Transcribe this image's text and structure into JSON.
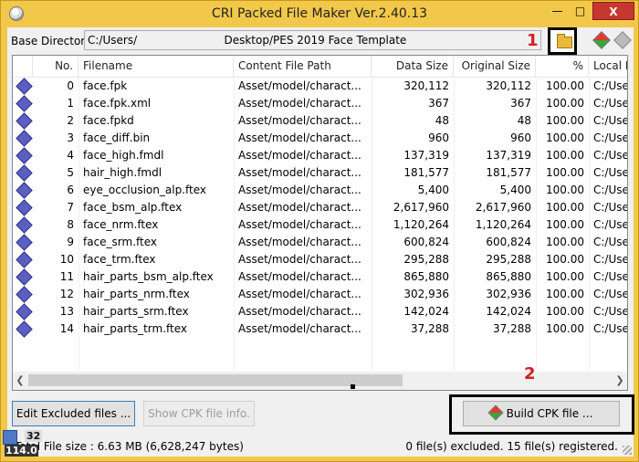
{
  "window": {
    "title": "CRI Packed File Maker Ver.2.40.13",
    "min_label": "—",
    "max_label": "□",
    "close_label": "X"
  },
  "base": {
    "label": "Base Directory",
    "value": "C:/Users/                         Desktop/PES 2019 Face Template"
  },
  "annotations": {
    "one": "1",
    "two": "2"
  },
  "table": {
    "headers": [
      "No.",
      "Filename",
      "Content File Path",
      "Data Size",
      "Original Size",
      "%",
      "Local I"
    ],
    "rows": [
      [
        "0",
        "face.fpk",
        "Asset/model/charact...",
        "320,112",
        "320,112",
        "100.00",
        "C:/Use"
      ],
      [
        "1",
        "face.fpk.xml",
        "Asset/model/charact...",
        "367",
        "367",
        "100.00",
        "C:/Use"
      ],
      [
        "2",
        "face.fpkd",
        "Asset/model/charact...",
        "48",
        "48",
        "100.00",
        "C:/Use"
      ],
      [
        "3",
        "face_diff.bin",
        "Asset/model/charact...",
        "960",
        "960",
        "100.00",
        "C:/Use"
      ],
      [
        "4",
        "face_high.fmdl",
        "Asset/model/charact...",
        "137,319",
        "137,319",
        "100.00",
        "C:/Use"
      ],
      [
        "5",
        "hair_high.fmdl",
        "Asset/model/charact...",
        "181,577",
        "181,577",
        "100.00",
        "C:/Use"
      ],
      [
        "6",
        "eye_occlusion_alp.ftex",
        "Asset/model/charact...",
        "5,400",
        "5,400",
        "100.00",
        "C:/Use"
      ],
      [
        "7",
        "face_bsm_alp.ftex",
        "Asset/model/charact...",
        "2,617,960",
        "2,617,960",
        "100.00",
        "C:/Use"
      ],
      [
        "8",
        "face_nrm.ftex",
        "Asset/model/charact...",
        "1,120,264",
        "1,120,264",
        "100.00",
        "C:/Use"
      ],
      [
        "9",
        "face_srm.ftex",
        "Asset/model/charact...",
        "600,824",
        "600,824",
        "100.00",
        "C:/Use"
      ],
      [
        "10",
        "face_trm.ftex",
        "Asset/model/charact...",
        "295,288",
        "295,288",
        "100.00",
        "C:/Use"
      ],
      [
        "11",
        "hair_parts_bsm_alp.ftex",
        "Asset/model/charact...",
        "865,880",
        "865,880",
        "100.00",
        "C:/Use"
      ],
      [
        "12",
        "hair_parts_nrm.ftex",
        "Asset/model/charact...",
        "302,936",
        "302,936",
        "100.00",
        "C:/Use"
      ],
      [
        "13",
        "hair_parts_srm.ftex",
        "Asset/model/charact...",
        "142,024",
        "142,024",
        "100.00",
        "C:/Use"
      ],
      [
        "14",
        "hair_parts_trm.ftex",
        "Asset/model/charact...",
        "37,288",
        "37,288",
        "100.00",
        "C:/Use"
      ]
    ]
  },
  "buttons": {
    "edit_excluded": "Edit Excluded files ...",
    "show_cpk_info": "Show CPK file info.",
    "build_cpk": "Build CPK file ..."
  },
  "status": {
    "total_size": "Total File size : 6.63 MB (6,628,247 bytes)",
    "summary": "0 file(s) excluded.  15 file(s) registered."
  },
  "overlay": {
    "count": "32",
    "number": "114.0"
  },
  "colors": {
    "frame": "#f2c84a",
    "close": "#c7372f",
    "annotation": "#d42020"
  }
}
